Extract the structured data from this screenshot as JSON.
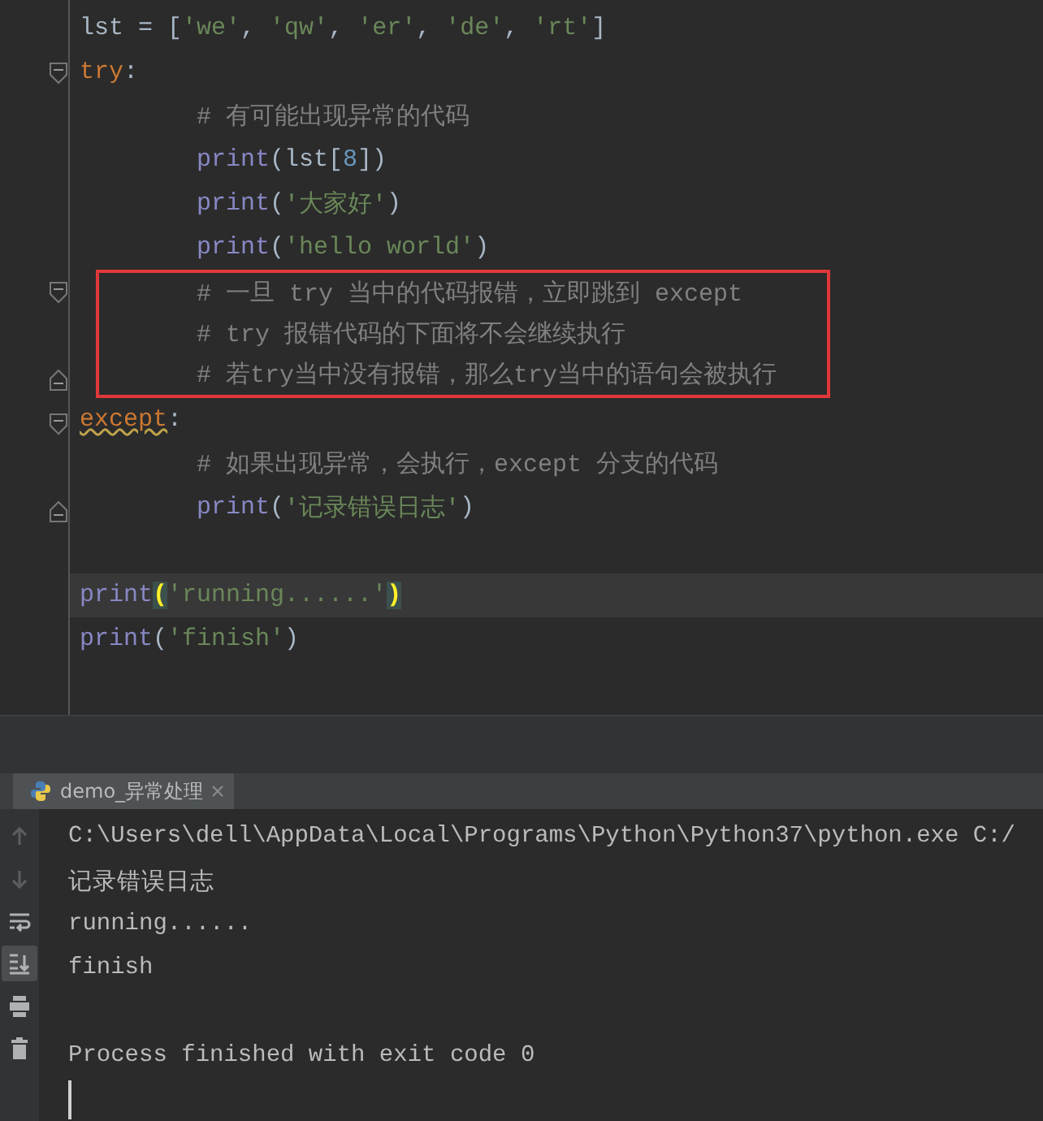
{
  "editor": {
    "lines": [
      {
        "indent": false,
        "fold_start": false,
        "fold_end": false,
        "current": false,
        "boxed": false,
        "tokens": [
          {
            "kind": "plain",
            "text": "lst = ["
          },
          {
            "kind": "string",
            "text": "'we'"
          },
          {
            "kind": "plain",
            "text": ", "
          },
          {
            "kind": "string",
            "text": "'qw'"
          },
          {
            "kind": "plain",
            "text": ", "
          },
          {
            "kind": "string",
            "text": "'er'"
          },
          {
            "kind": "plain",
            "text": ", "
          },
          {
            "kind": "string",
            "text": "'de'"
          },
          {
            "kind": "plain",
            "text": ", "
          },
          {
            "kind": "string",
            "text": "'rt'"
          },
          {
            "kind": "plain",
            "text": "]"
          }
        ]
      },
      {
        "indent": false,
        "fold_start": true,
        "fold_end": false,
        "current": false,
        "boxed": false,
        "tokens": [
          {
            "kind": "keyword",
            "text": "try"
          },
          {
            "kind": "plain",
            "text": ":"
          }
        ]
      },
      {
        "indent": true,
        "fold_start": false,
        "fold_end": false,
        "current": false,
        "boxed": false,
        "tokens": [
          {
            "kind": "comment",
            "text": "# 有可能出现异常的代码"
          }
        ]
      },
      {
        "indent": true,
        "fold_start": false,
        "fold_end": false,
        "current": false,
        "boxed": false,
        "tokens": [
          {
            "kind": "builtin",
            "text": "print"
          },
          {
            "kind": "plain",
            "text": "(lst["
          },
          {
            "kind": "number",
            "text": "8"
          },
          {
            "kind": "plain",
            "text": "])"
          }
        ]
      },
      {
        "indent": true,
        "fold_start": false,
        "fold_end": false,
        "current": false,
        "boxed": false,
        "tokens": [
          {
            "kind": "builtin",
            "text": "print"
          },
          {
            "kind": "plain",
            "text": "("
          },
          {
            "kind": "string",
            "text": "'大家好'"
          },
          {
            "kind": "plain",
            "text": ")"
          }
        ]
      },
      {
        "indent": true,
        "fold_start": false,
        "fold_end": false,
        "current": false,
        "boxed": false,
        "tokens": [
          {
            "kind": "builtin",
            "text": "print"
          },
          {
            "kind": "plain",
            "text": "("
          },
          {
            "kind": "string",
            "text": "'hello world'"
          },
          {
            "kind": "plain",
            "text": ")"
          }
        ]
      },
      {
        "indent": true,
        "fold_start": true,
        "fold_end": false,
        "current": false,
        "boxed": true,
        "tokens": [
          {
            "kind": "comment",
            "text": "# 一旦 try 当中的代码报错，立即跳到 except"
          }
        ]
      },
      {
        "indent": true,
        "fold_start": false,
        "fold_end": false,
        "current": false,
        "boxed": true,
        "tokens": [
          {
            "kind": "comment",
            "text": "# try 报错代码的下面将不会继续执行"
          }
        ]
      },
      {
        "indent": true,
        "fold_start": false,
        "fold_end": true,
        "current": false,
        "boxed": true,
        "tokens": [
          {
            "kind": "comment",
            "text": "# 若try当中没有报错，那么try当中的语句会被执行"
          }
        ]
      },
      {
        "indent": false,
        "fold_start": true,
        "fold_end": false,
        "current": false,
        "boxed": false,
        "tokens": [
          {
            "kind": "keyword_warned",
            "text": "except"
          },
          {
            "kind": "plain",
            "text": ":"
          }
        ]
      },
      {
        "indent": true,
        "fold_start": false,
        "fold_end": false,
        "current": false,
        "boxed": false,
        "tokens": [
          {
            "kind": "comment",
            "text": "# 如果出现异常，会执行，except 分支的代码"
          }
        ]
      },
      {
        "indent": true,
        "fold_start": false,
        "fold_end": true,
        "current": false,
        "boxed": false,
        "tokens": [
          {
            "kind": "builtin",
            "text": "print"
          },
          {
            "kind": "plain",
            "text": "("
          },
          {
            "kind": "string",
            "text": "'记录错误日志'"
          },
          {
            "kind": "plain",
            "text": ")"
          }
        ]
      },
      {
        "fold_start": false,
        "fold_end": false,
        "current": false,
        "boxed": false
      },
      {
        "indent": false,
        "fold_start": false,
        "fold_end": false,
        "current": true,
        "boxed": false,
        "tokens": [
          {
            "kind": "builtin",
            "text": "print"
          },
          {
            "kind": "brace_match",
            "text": "("
          },
          {
            "kind": "string",
            "text": "'running......'"
          },
          {
            "kind": "brace_match",
            "text": ")"
          }
        ]
      },
      {
        "indent": false,
        "fold_start": false,
        "fold_end": false,
        "current": false,
        "boxed": false,
        "tokens": [
          {
            "kind": "builtin",
            "text": "print"
          },
          {
            "kind": "plain",
            "text": "("
          },
          {
            "kind": "string",
            "text": "'finish'"
          },
          {
            "kind": "plain",
            "text": ")"
          }
        ]
      }
    ]
  },
  "run_panel": {
    "tabs": [
      {
        "label": "demo_异常处理",
        "selected": true
      }
    ],
    "tools": [
      {
        "kind": "up",
        "disabled": true,
        "selected": false
      },
      {
        "kind": "down",
        "disabled": true,
        "selected": false
      },
      {
        "kind": "wrap",
        "disabled": false,
        "selected": false
      },
      {
        "kind": "scroll_end",
        "disabled": false,
        "selected": true
      },
      {
        "kind": "print",
        "disabled": false,
        "selected": false
      },
      {
        "kind": "trash",
        "disabled": false,
        "selected": false
      }
    ],
    "output": [
      {
        "kind": "text",
        "text": "C:\\Users\\dell\\AppData\\Local\\Programs\\Python\\Python37\\python.exe C:/"
      },
      {
        "kind": "text",
        "text": "记录错误日志"
      },
      {
        "kind": "text",
        "text": "running......"
      },
      {
        "kind": "text",
        "text": "finish"
      },
      {
        "kind": "blank"
      },
      {
        "kind": "text",
        "text": "Process finished with exit code 0"
      },
      {
        "kind": "cursor"
      }
    ]
  }
}
